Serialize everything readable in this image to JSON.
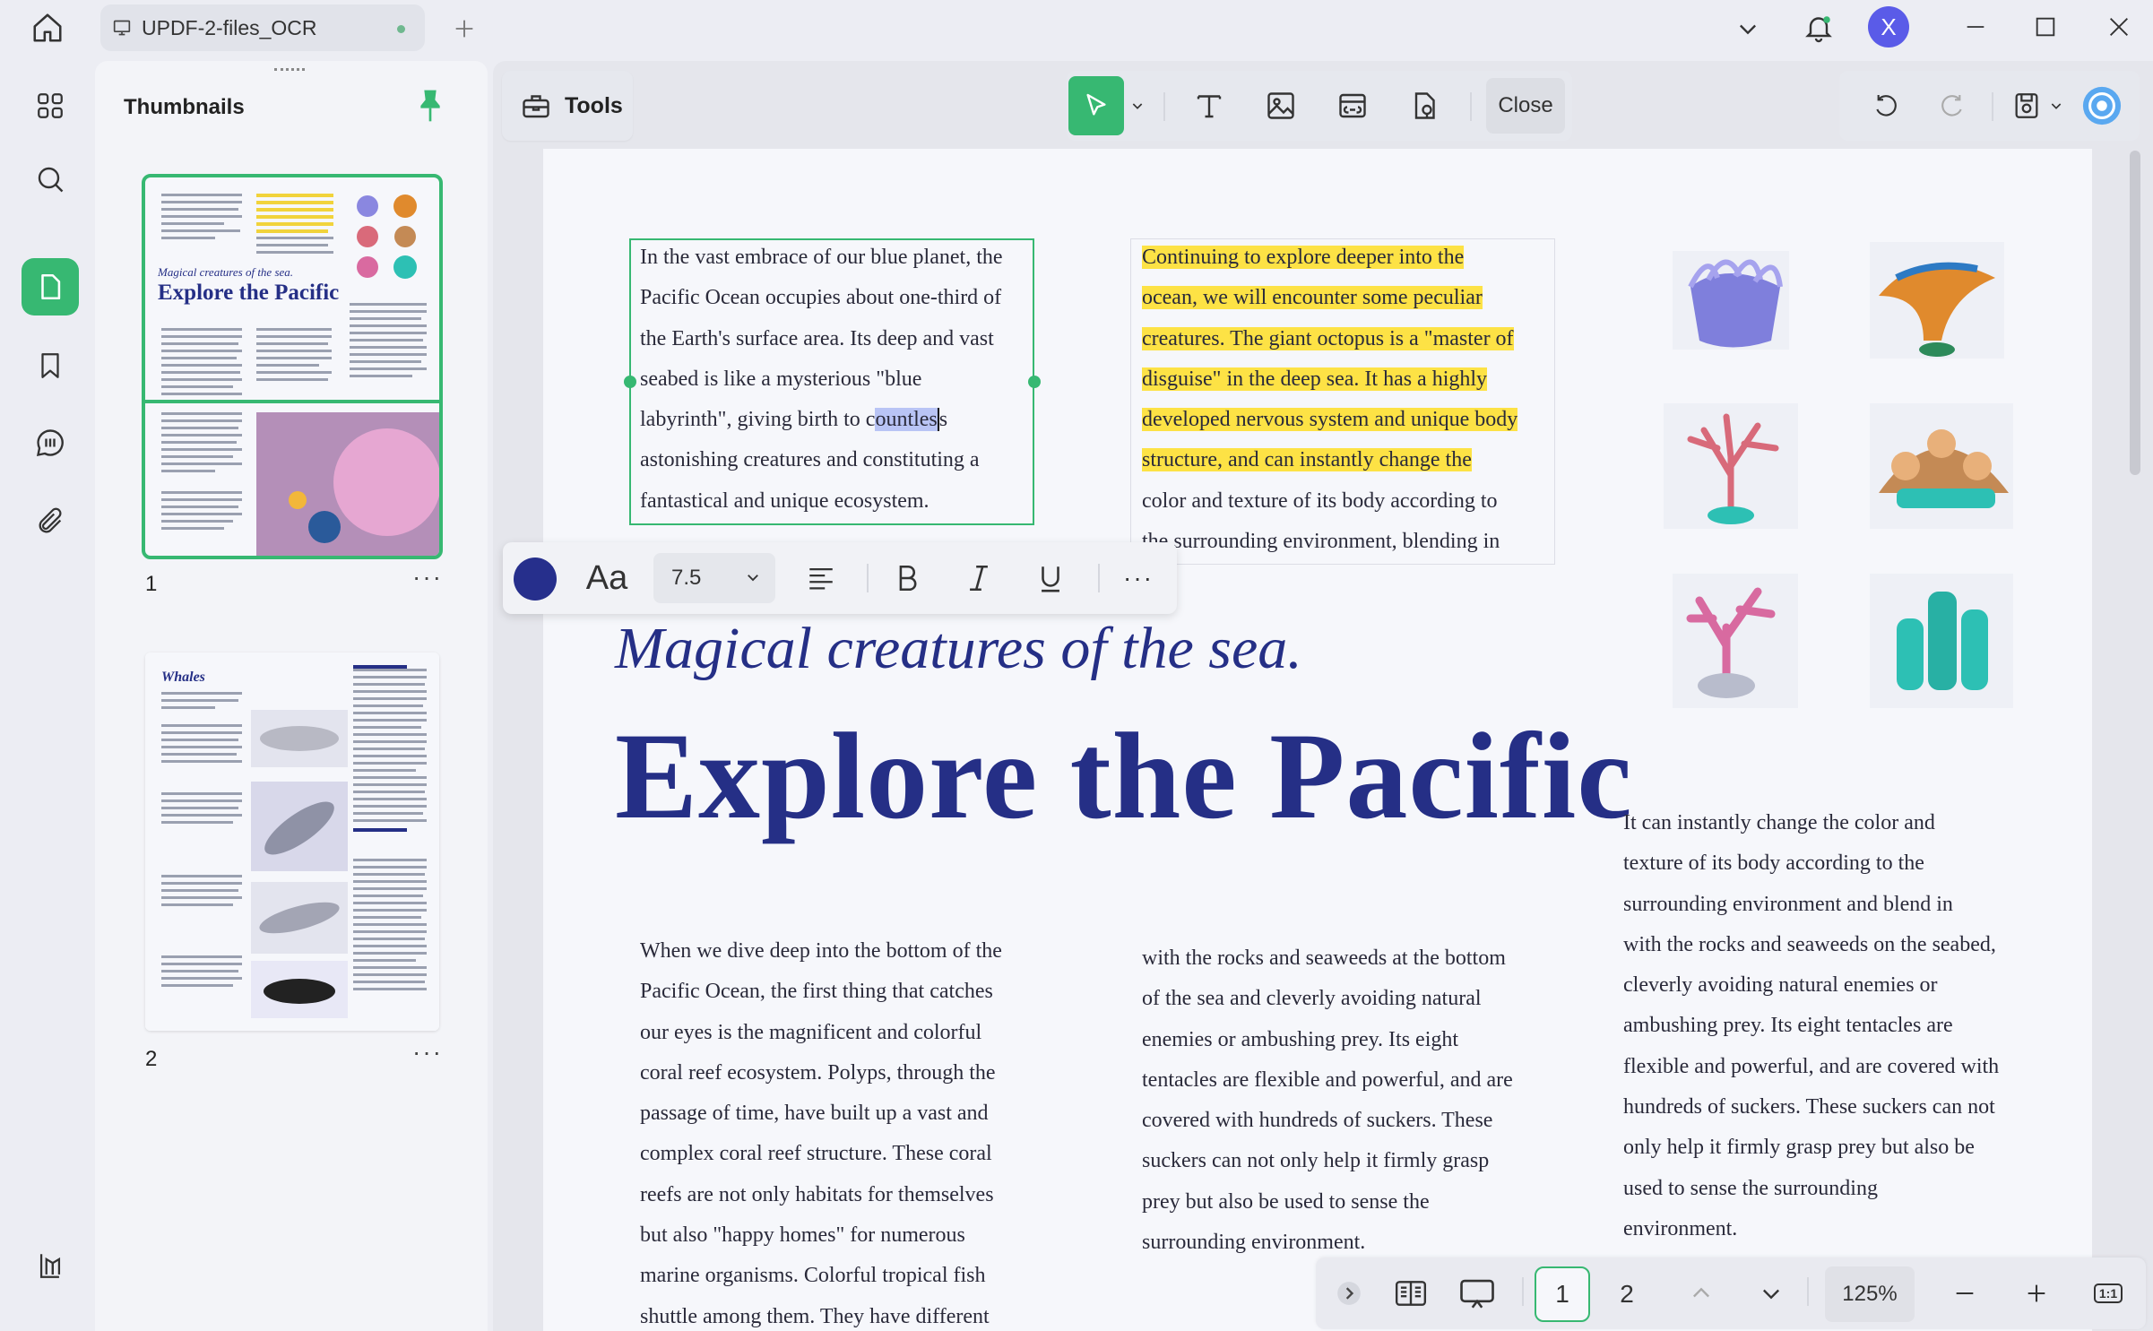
{
  "titlebar": {
    "file_name": "UPDF-2-files_OCR",
    "avatar_letter": "X",
    "icons": [
      "home-icon",
      "monitor-icon",
      "plus-icon",
      "chevron-down-icon",
      "bell-icon",
      "minimize-icon",
      "maximize-icon",
      "close-icon"
    ]
  },
  "rail": {
    "items": [
      "apps-icon",
      "search-icon",
      "pages-icon",
      "bookmark-icon",
      "comment-icon",
      "attachment-icon",
      "layers-icon"
    ],
    "active": "pages-icon"
  },
  "thumbnails": {
    "title": "Thumbnails",
    "pages": [
      {
        "number": "1",
        "more": "···",
        "heading": "Explore the Pacific",
        "subheading": "Magical creatures of the sea."
      },
      {
        "number": "2",
        "more": "···",
        "heading": "Whales"
      }
    ]
  },
  "toolbar": {
    "tools_label": "Tools",
    "close_label": "Close"
  },
  "document": {
    "para1": [
      "In the vast embrace of our blue planet, the",
      "Pacific Ocean occupies about one-third of",
      "the Earth's surface area. Its deep and vast",
      "seabed is like a mysterious \"blue",
      "labyrinth\", giving birth to",
      "astonishing creatures and constituting a",
      "fantastical and unique ecosystem."
    ],
    "para1_line5_pre": "labyrinth\", giving birth to ",
    "para1_line5_c": "c",
    "para1_line5_sel": "ountles",
    "para1_line5_post": "s",
    "para2_highlighted": [
      "Continuing to explore deeper into the",
      "ocean, we will encounter some peculiar",
      "creatures. The giant octopus is a \"master of",
      "disguise\" in the deep sea. It has a highly",
      "developed nervous system and unique body",
      "structure, and can instantly change the"
    ],
    "para2_rest": [
      "color and texture of its body according to",
      "the surrounding environment, blending in"
    ],
    "subtitle": "Magical creatures of the sea.",
    "title": "Explore the Pacific",
    "col1": [
      "When we dive deep into the bottom of the",
      "Pacific Ocean, the first thing that catches",
      "our eyes is the magnificent and colorful",
      "coral reef ecosystem. Polyps, through the",
      "passage of time, have built up a vast and",
      "complex coral reef structure. These coral",
      "reefs are not only habitats for themselves",
      "but also \"happy homes\" for numerous",
      "marine organisms. Colorful tropical fish",
      "shuttle among them. They have different"
    ],
    "col2": [
      "with the rocks and seaweeds at the bottom",
      "of the sea and cleverly avoiding natural",
      "enemies or ambushing prey. Its eight",
      "tentacles are flexible and powerful, and are",
      "covered with hundreds of suckers. These",
      "suckers can not only help it firmly grasp",
      "prey but also be used to sense the",
      "surrounding environment."
    ],
    "col3": [
      "It can instantly change the color and",
      "texture of its body according to the",
      "surrounding environment and blend in",
      "with the rocks and seaweeds on the seabed,",
      "cleverly avoiding natural enemies or",
      "ambushing prey. Its eight tentacles are",
      "flexible and powerful, and are covered with",
      "hundreds of suckers. These suckers can not",
      "only help it firmly grasp prey but also be",
      "used to sense the surrounding",
      "environment."
    ]
  },
  "format_toolbar": {
    "font_icon": "Aa",
    "font_size": "7.5",
    "more": "···",
    "text_color": "#262f8c"
  },
  "bottom_nav": {
    "pages": [
      "1",
      "2"
    ],
    "current_page": "1",
    "zoom": "125%",
    "fit_label": "1:1"
  },
  "colors": {
    "accent": "#37b872",
    "heading": "#252f86",
    "highlight": "#fde245",
    "avatar": "#5a5be8"
  }
}
